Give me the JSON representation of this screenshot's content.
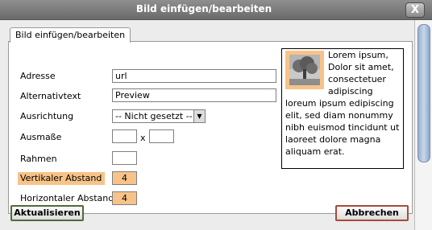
{
  "window": {
    "title": "Bild einfügen/bearbeiten",
    "close_glyph": "X"
  },
  "tab": {
    "label": "Bild einfügen/bearbeiten"
  },
  "form": {
    "source": {
      "label": "Adresse",
      "value": "url"
    },
    "alt": {
      "label": "Alternativtext",
      "value": "Preview"
    },
    "align": {
      "label": "Ausrichtung",
      "selected": "-- Nicht gesetzt --"
    },
    "dimensions": {
      "label": "Ausmaße",
      "width": "",
      "height": "",
      "separator": "x"
    },
    "border": {
      "label": "Rahmen",
      "value": ""
    },
    "vspace": {
      "label": "Vertikaler Abstand",
      "value": "4"
    },
    "hspace": {
      "label": "Horizontaler Abstand",
      "value": "4"
    }
  },
  "preview": {
    "text": "Lorem ipsum, Dolor sit amet, consectetuer adipiscing loreum ipsum edipiscing elit, sed diam nonummy nibh euismod tincidunt ut laoreet dolore magna aliquam erat.",
    "image_icon": "tree-image-icon"
  },
  "buttons": {
    "update": "Aktualisieren",
    "cancel": "Abbrechen"
  },
  "colors": {
    "highlight": "#f8c388",
    "titlebar": "#7a7a7a"
  }
}
